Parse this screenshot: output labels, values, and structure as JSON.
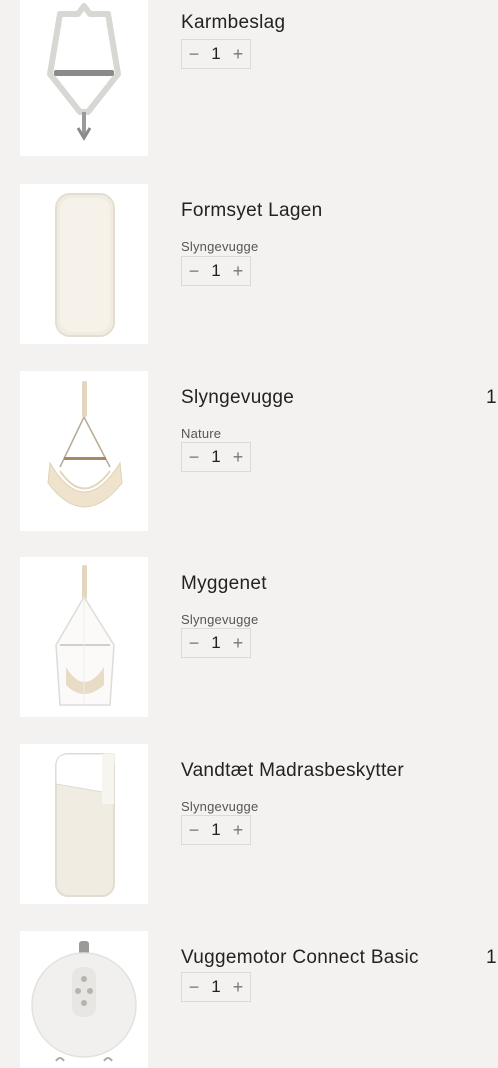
{
  "cart": {
    "items": [
      {
        "title": "Karmbeslag",
        "variant": "",
        "qty": "1",
        "price": "",
        "minus": "−",
        "plus": "+",
        "image": "door-frame-bracket"
      },
      {
        "title": "Formsyet Lagen",
        "variant": "Slyngevugge",
        "qty": "1",
        "price": "",
        "minus": "−",
        "plus": "+",
        "image": "fitted-sheet"
      },
      {
        "title": "Slyngevugge",
        "variant": "Nature",
        "qty": "1",
        "price": "1",
        "minus": "−",
        "plus": "+",
        "image": "hammock-cradle"
      },
      {
        "title": "Myggenet",
        "variant": "Slyngevugge",
        "qty": "1",
        "price": "",
        "minus": "−",
        "plus": "+",
        "image": "mosquito-net"
      },
      {
        "title": "Vandtæt Madrasbeskytter",
        "variant": "Slyngevugge",
        "qty": "1",
        "price": "",
        "minus": "−",
        "plus": "+",
        "image": "waterproof-mattress-protector"
      },
      {
        "title": "Vuggemotor Connect Basic",
        "variant": "",
        "qty": "1",
        "price": "1",
        "minus": "−",
        "plus": "+",
        "image": "cradle-motor"
      }
    ]
  },
  "colors": {
    "background": "#f3f2f0",
    "text": "#222222",
    "border": "#dddad6"
  }
}
